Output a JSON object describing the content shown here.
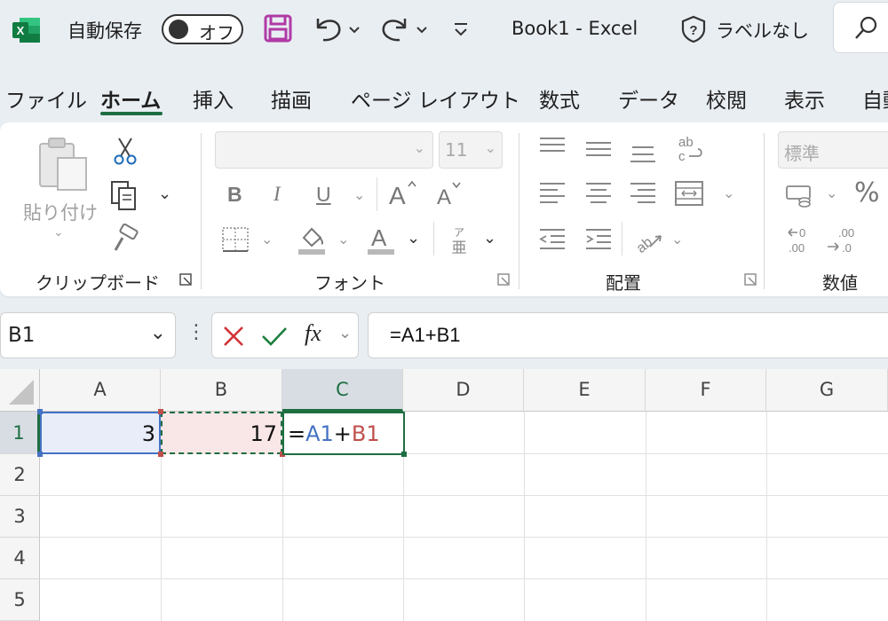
{
  "app": {
    "autosave_label": "自動保存",
    "autosave_toggle": "オフ",
    "window_title": "Book1  -  Excel",
    "sensitivity_label": "ラベルなし"
  },
  "tabs": [
    "ファイル",
    "ホーム",
    "挿入",
    "描画",
    "ページ レイアウト",
    "数式",
    "データ",
    "校閲",
    "表示",
    "自動"
  ],
  "active_tab": "ホーム",
  "ribbon": {
    "clipboard": {
      "paste_label": "貼り付け",
      "group_label": "クリップボード"
    },
    "font": {
      "font_name": "",
      "font_size": "11",
      "bold": "B",
      "italic": "I",
      "underline": "U",
      "group_label": "フォント"
    },
    "alignment": {
      "group_label": "配置"
    },
    "number": {
      "format": "標準",
      "percent": "%",
      "group_label": "数値"
    }
  },
  "formula_bar": {
    "name_box": "B1",
    "fx_label": "fx",
    "formula": "=A1+B1"
  },
  "sheet": {
    "columns": [
      "A",
      "B",
      "C",
      "D",
      "E",
      "F",
      "G"
    ],
    "rows": [
      "1",
      "2",
      "3",
      "4",
      "5"
    ],
    "cells": {
      "A1": "3",
      "B1": "17",
      "C1_eq": "=",
      "C1_ref1": "A1",
      "C1_op": "+",
      "C1_ref2": "B1"
    }
  },
  "colors": {
    "accent": "#1e6e42",
    "ref_blue": "#4472c4",
    "ref_red": "#c0504d",
    "ref_blue_fill": "#e8edf9",
    "ref_red_fill": "#f9e6e6"
  }
}
